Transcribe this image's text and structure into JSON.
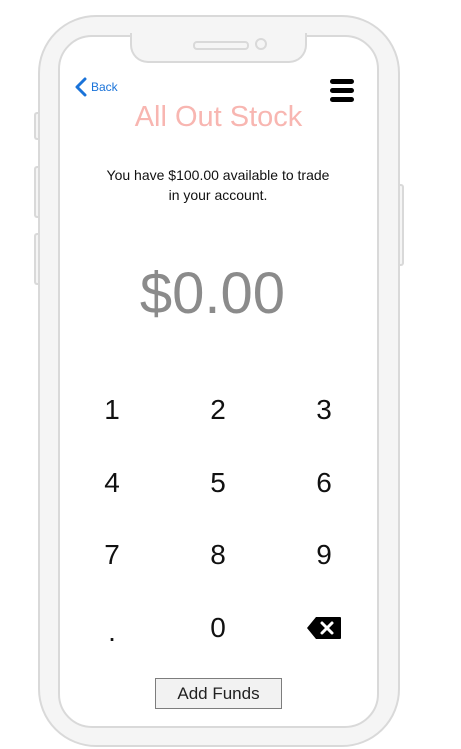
{
  "nav": {
    "back_label": "Back",
    "back_icon": "chevron-left-icon",
    "menu_icon": "hamburger-menu-icon"
  },
  "app": {
    "title": "All Out Stock",
    "title_color": "#f8b6b1"
  },
  "balance": {
    "line1": "You have $100.00 available to trade",
    "line2": "in your account."
  },
  "trade": {
    "amount": "$0.00"
  },
  "keypad": {
    "k1": "1",
    "k2": "2",
    "k3": "3",
    "k4": "4",
    "k5": "5",
    "k6": "6",
    "k7": "7",
    "k8": "8",
    "k9": "9",
    "kdot": ".",
    "k0": "0",
    "delete_icon": "backspace-icon"
  },
  "actions": {
    "add_funds_label": "Add Funds"
  },
  "colors": {
    "link": "#1a73d9",
    "amount": "#8b8b8b"
  }
}
